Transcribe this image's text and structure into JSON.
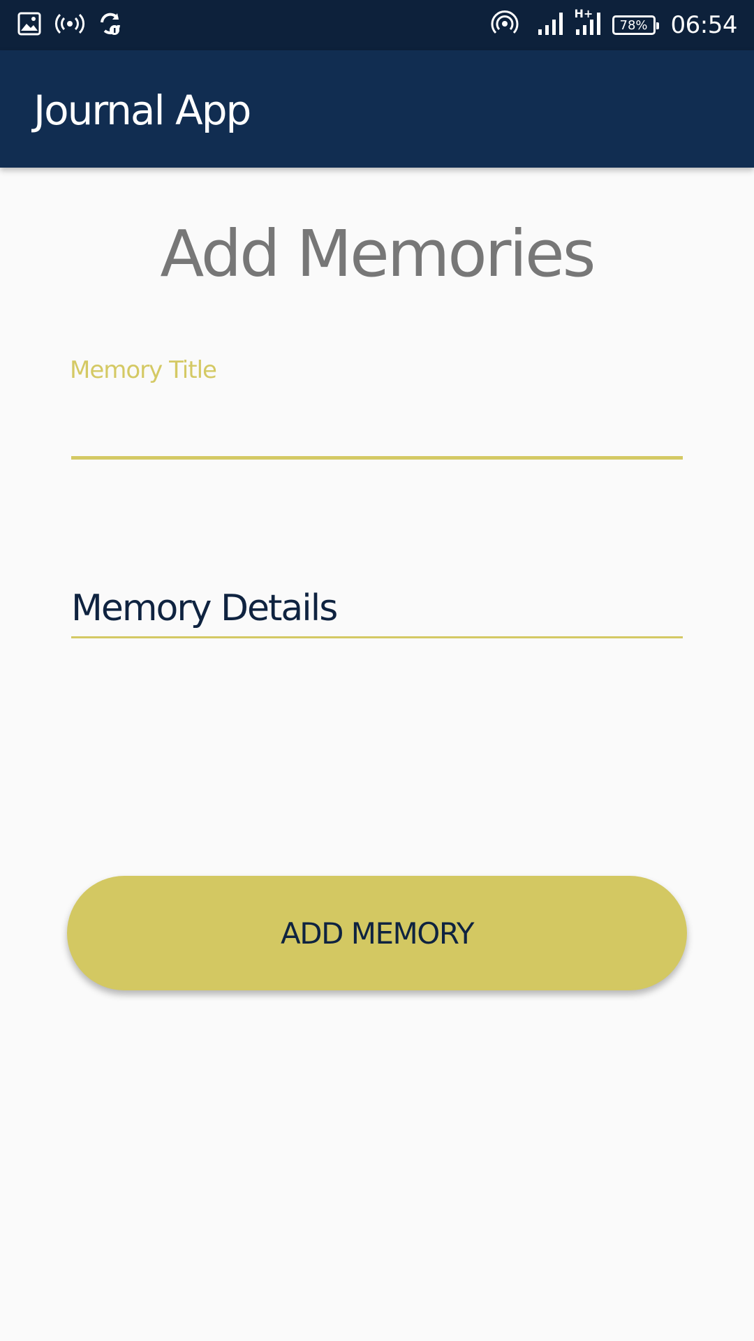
{
  "status_bar": {
    "icons_left": [
      "image-icon",
      "hotspot-icon",
      "sync-icon"
    ],
    "icons_right": [
      "airdrop-icon",
      "signal-icon",
      "signal-hplus-icon",
      "battery-icon"
    ],
    "network_label": "H+",
    "battery_percent": "78%",
    "time": "06:54"
  },
  "app_bar": {
    "title": "Journal App",
    "background_color": "#112d51"
  },
  "main": {
    "heading": "Add Memories",
    "title_field": {
      "floating_label": "Memory Title",
      "value": ""
    },
    "details_field": {
      "placeholder": "Memory Details",
      "value": ""
    },
    "add_button_label": "ADD MEMORY"
  },
  "colors": {
    "accent": "#d4c964",
    "primary_dark": "#0d213b",
    "primary": "#112d51",
    "heading_gray": "#777777"
  }
}
